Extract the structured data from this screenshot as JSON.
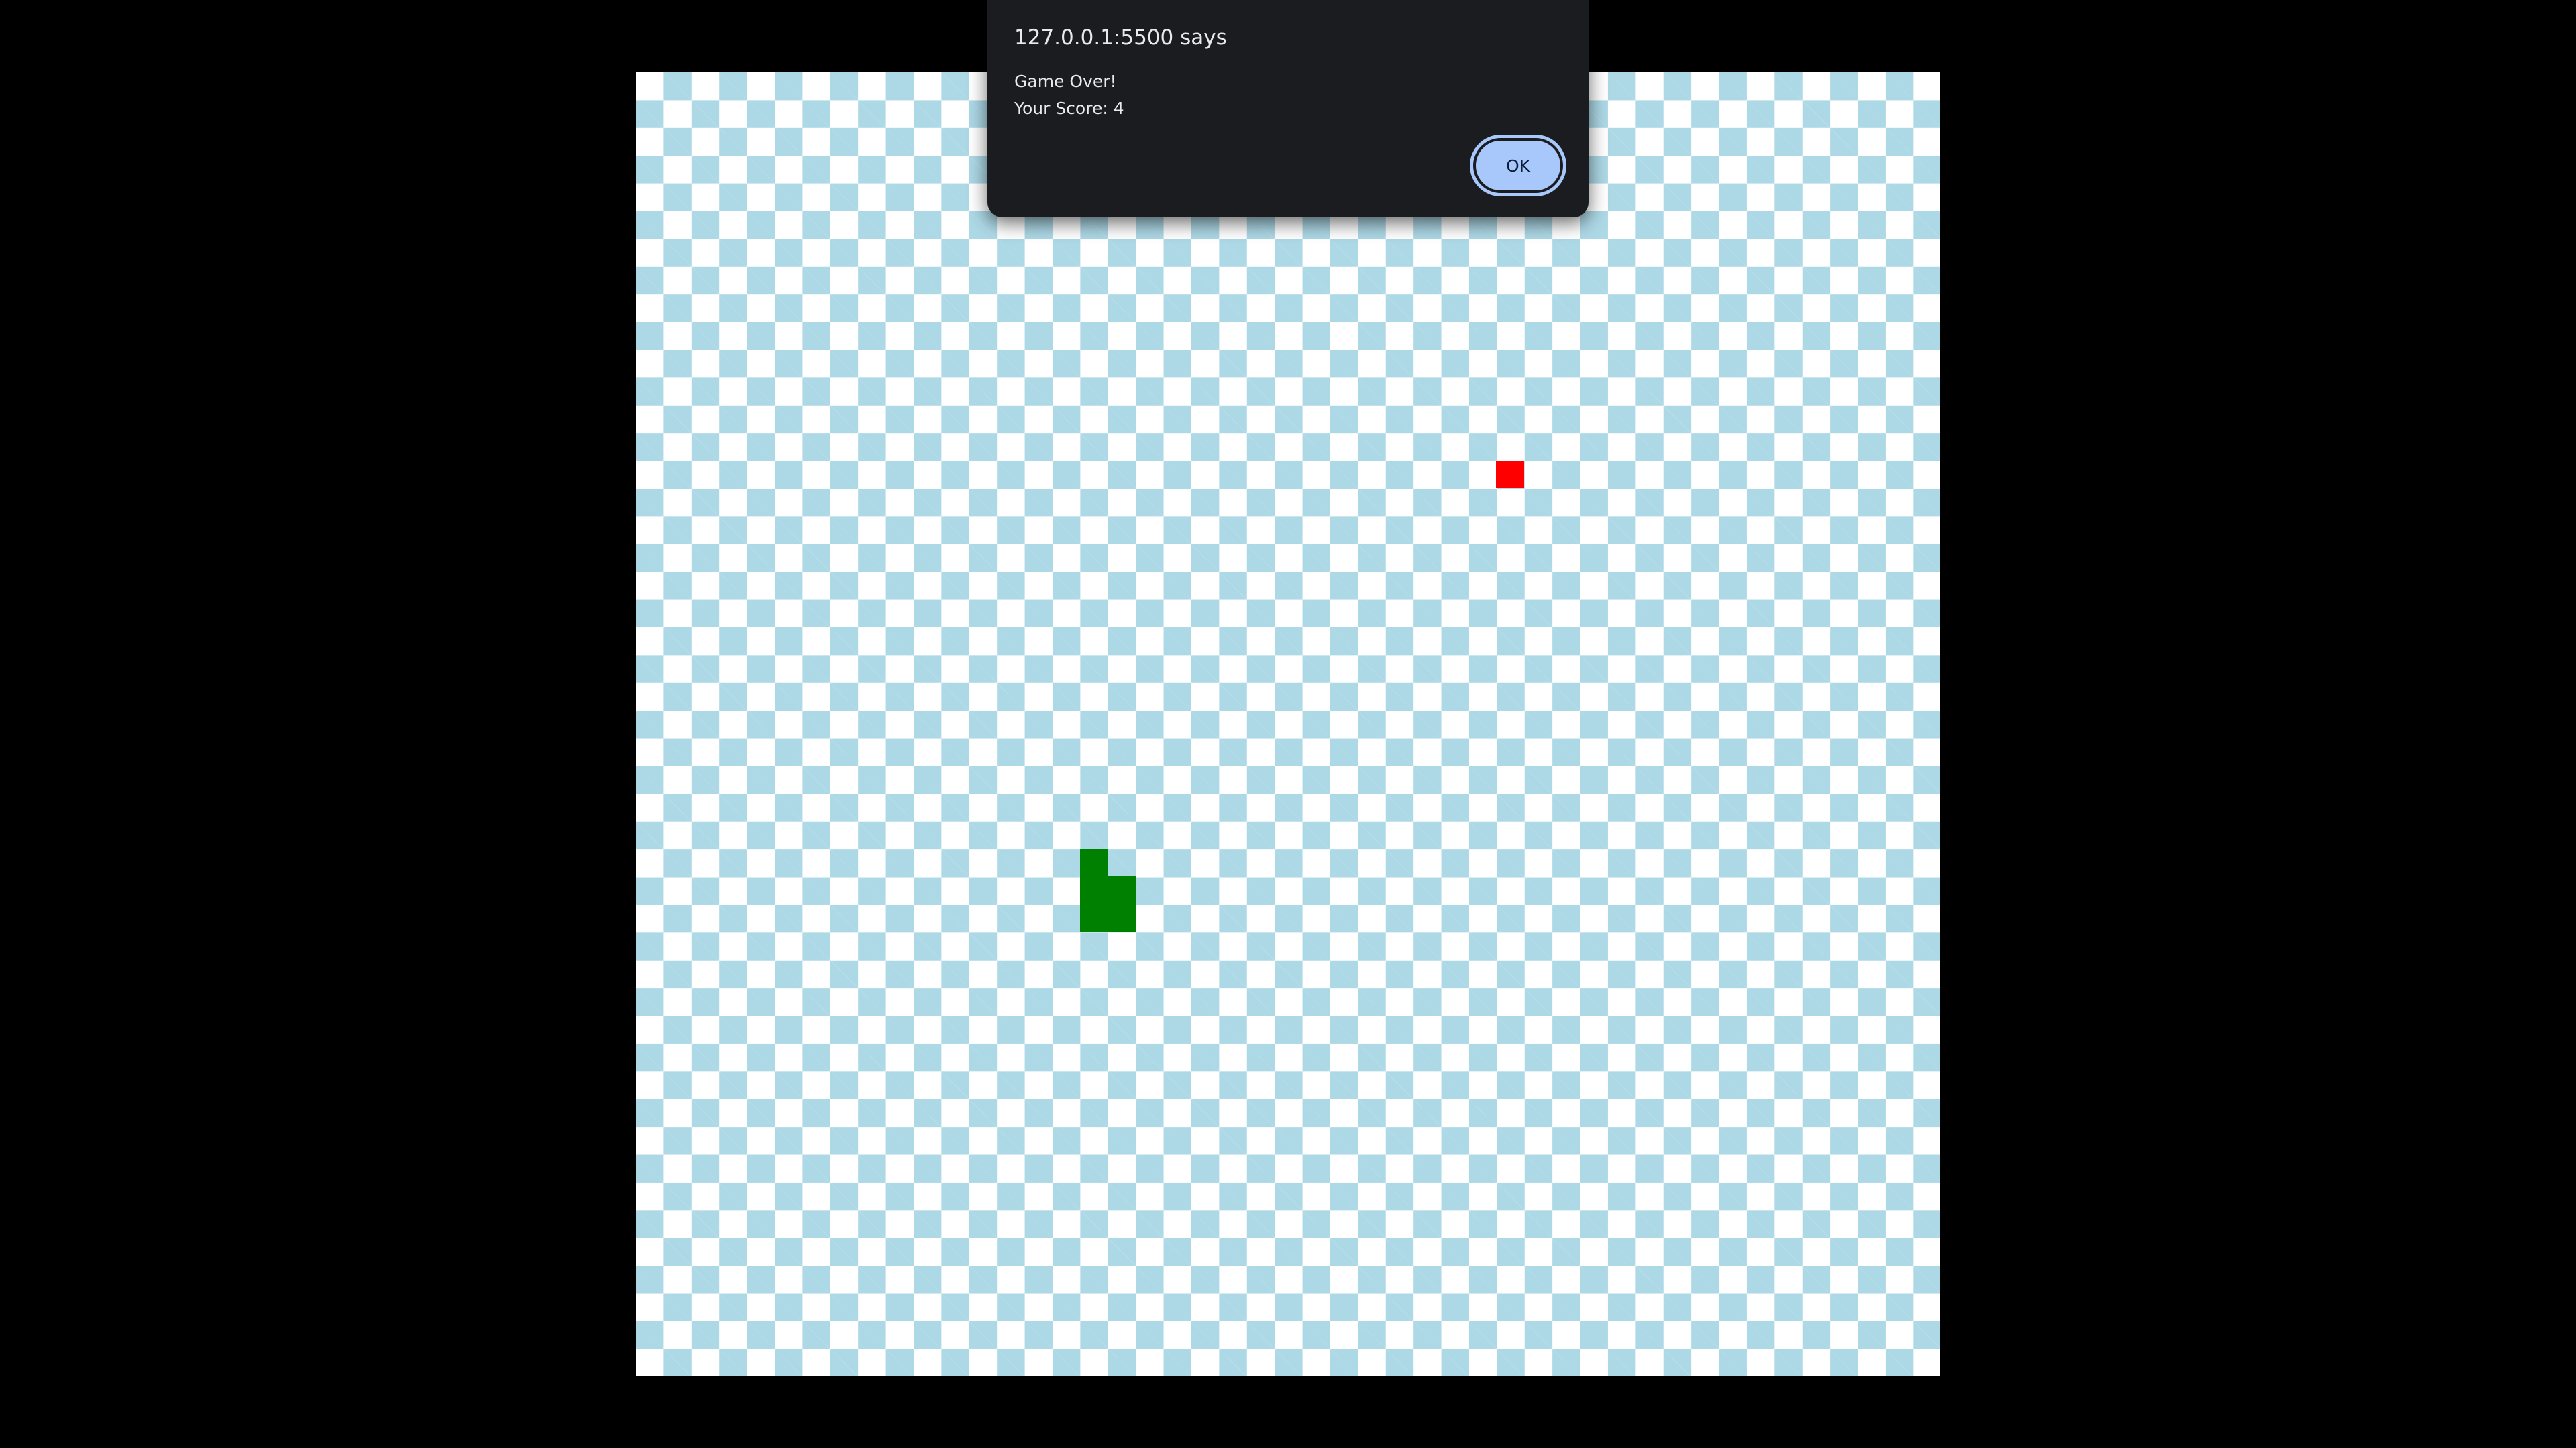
{
  "dialog": {
    "title": "127.0.0.1:5500 says",
    "message_line1": "Game Over!",
    "message_line2": "Your Score: 4",
    "ok_label": "OK"
  },
  "game": {
    "grid_size": 47,
    "colors": {
      "page_background": "#000000",
      "board_light": "#ffffff",
      "board_dark": "#add8e6",
      "snake": "#008000",
      "food": "#ff0000",
      "dialog_background": "#1b1c20",
      "button_background": "#a8c7fa"
    },
    "food": {
      "col": 31,
      "row": 14
    },
    "snake": [
      {
        "col": 16,
        "row": 28
      },
      {
        "col": 16,
        "row": 29
      },
      {
        "col": 17,
        "row": 29
      },
      {
        "col": 16,
        "row": 30
      },
      {
        "col": 17,
        "row": 30
      }
    ]
  }
}
